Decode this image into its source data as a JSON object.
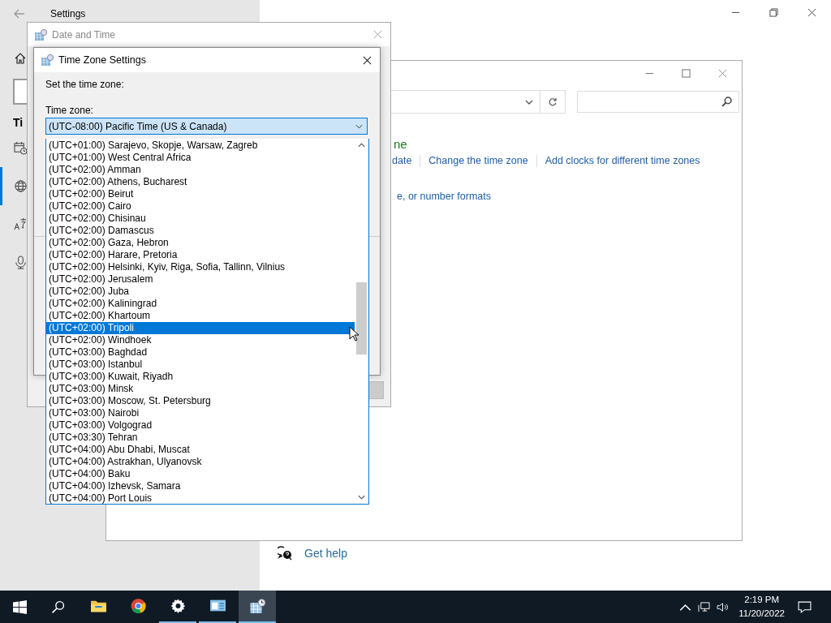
{
  "settings": {
    "title": "Settings",
    "section_heading": "Ti",
    "sidebar": {
      "items": [
        {
          "kind": "calendar",
          "selected": false
        },
        {
          "kind": "globe",
          "selected": true
        },
        {
          "kind": "language",
          "selected": false
        },
        {
          "kind": "microphone",
          "selected": false
        }
      ]
    }
  },
  "control_panel": {
    "heading": "ne",
    "links": [
      "date",
      "Change the time zone",
      "Add clocks for different time zones"
    ],
    "link_2": "e, or number formats",
    "get_help": "Get help"
  },
  "date_and_time_dialog": {
    "title": "Date and Time",
    "active": false
  },
  "time_zone_dialog": {
    "title": "Time Zone Settings",
    "prompt": "Set the time zone:",
    "label": "Time zone:",
    "value": "(UTC-08:00) Pacific Time (US & Canada)",
    "options": [
      {
        "label": "(UTC+01:00) Sarajevo, Skopje, Warsaw, Zagreb",
        "selected": false
      },
      {
        "label": "(UTC+01:00) West Central Africa",
        "selected": false
      },
      {
        "label": "(UTC+02:00) Amman",
        "selected": false
      },
      {
        "label": "(UTC+02:00) Athens, Bucharest",
        "selected": false
      },
      {
        "label": "(UTC+02:00) Beirut",
        "selected": false
      },
      {
        "label": "(UTC+02:00) Cairo",
        "selected": false
      },
      {
        "label": "(UTC+02:00) Chisinau",
        "selected": false
      },
      {
        "label": "(UTC+02:00) Damascus",
        "selected": false
      },
      {
        "label": "(UTC+02:00) Gaza, Hebron",
        "selected": false
      },
      {
        "label": "(UTC+02:00) Harare, Pretoria",
        "selected": false
      },
      {
        "label": "(UTC+02:00) Helsinki, Kyiv, Riga, Sofia, Tallinn, Vilnius",
        "selected": false
      },
      {
        "label": "(UTC+02:00) Jerusalem",
        "selected": false
      },
      {
        "label": "(UTC+02:00) Juba",
        "selected": false
      },
      {
        "label": "(UTC+02:00) Kaliningrad",
        "selected": false
      },
      {
        "label": "(UTC+02:00) Khartoum",
        "selected": false
      },
      {
        "label": "(UTC+02:00) Tripoli",
        "selected": true
      },
      {
        "label": "(UTC+02:00) Windhoek",
        "selected": false
      },
      {
        "label": "(UTC+03:00) Baghdad",
        "selected": false
      },
      {
        "label": "(UTC+03:00) Istanbul",
        "selected": false
      },
      {
        "label": "(UTC+03:00) Kuwait, Riyadh",
        "selected": false
      },
      {
        "label": "(UTC+03:00) Minsk",
        "selected": false
      },
      {
        "label": "(UTC+03:00) Moscow, St. Petersburg",
        "selected": false
      },
      {
        "label": "(UTC+03:00) Nairobi",
        "selected": false
      },
      {
        "label": "(UTC+03:00) Volgograd",
        "selected": false
      },
      {
        "label": "(UTC+03:30) Tehran",
        "selected": false
      },
      {
        "label": "(UTC+04:00) Abu Dhabi, Muscat",
        "selected": false
      },
      {
        "label": "(UTC+04:00) Astrakhan, Ulyanovsk",
        "selected": false
      },
      {
        "label": "(UTC+04:00) Baku",
        "selected": false
      },
      {
        "label": "(UTC+04:00) Izhevsk, Samara",
        "selected": false
      },
      {
        "label": "(UTC+04:00) Port Louis",
        "selected": false
      }
    ]
  },
  "taskbar": {
    "apps": [
      {
        "kind": "folder",
        "running": false,
        "active": false
      },
      {
        "kind": "browser",
        "running": false,
        "active": false
      },
      {
        "kind": "gear",
        "running": true,
        "active": false
      },
      {
        "kind": "control",
        "running": true,
        "active": false
      },
      {
        "kind": "clock",
        "running": true,
        "active": true
      }
    ],
    "time": "2:19 PM",
    "date": "11/20/2022"
  }
}
